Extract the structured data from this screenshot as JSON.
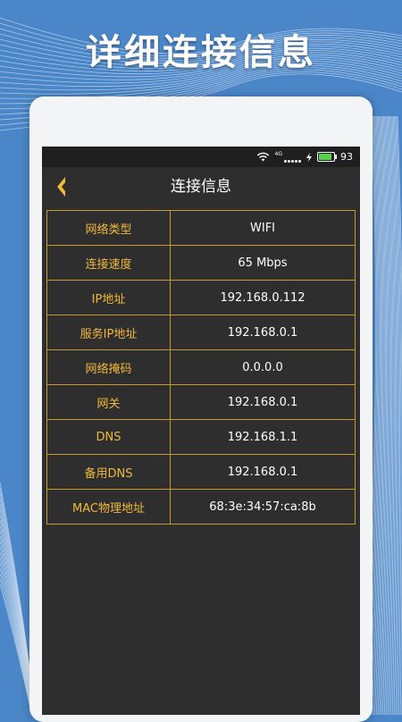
{
  "promo": {
    "headline": "详细连接信息"
  },
  "statusbar": {
    "network": "4G",
    "battery": "93",
    "battery_level": 0.93
  },
  "appbar": {
    "title": "连接信息",
    "back_icon": "chevron-left-icon"
  },
  "info_rows": [
    {
      "label": "网络类型",
      "value": "WIFI"
    },
    {
      "label": "连接速度",
      "value": "65 Mbps"
    },
    {
      "label": "IP地址",
      "value": "192.168.0.112"
    },
    {
      "label": "服务IP地址",
      "value": "192.168.0.1"
    },
    {
      "label": "网络掩码",
      "value": "0.0.0.0"
    },
    {
      "label": "网关",
      "value": "192.168.0.1"
    },
    {
      "label": "DNS",
      "value": "192.168.1.1"
    },
    {
      "label": "备用DNS",
      "value": "192.168.0.1"
    },
    {
      "label": "MAC物理地址",
      "value": "68:3e:34:57:ca:8b"
    }
  ],
  "colors": {
    "accent": "#f0b93a",
    "background": "#4a86c8",
    "screen": "#2e2e2e"
  }
}
